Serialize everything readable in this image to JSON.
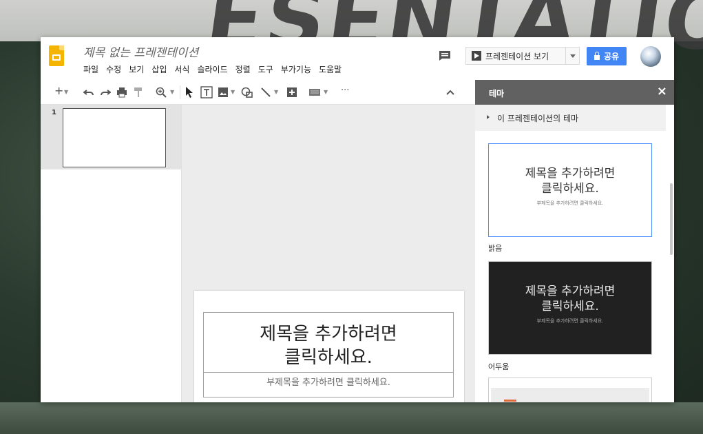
{
  "background": {
    "watermark": "ESENTATIO"
  },
  "header": {
    "doc_title": "제목 없는 프레젠테이션",
    "menu": [
      "파일",
      "수정",
      "보기",
      "삽입",
      "서식",
      "슬라이드",
      "정렬",
      "도구",
      "부가기능",
      "도움말"
    ],
    "present_label": "프레젠테이션 보기",
    "share_label": "공유",
    "accent_color": "#4285f4"
  },
  "toolbar": {
    "icons": [
      "plus-icon",
      "undo-icon",
      "redo-icon",
      "print-icon",
      "paint-format-icon",
      "zoom-icon",
      "select-icon",
      "text-box-icon",
      "image-icon",
      "shape-icon",
      "line-icon",
      "add-comment-icon",
      "layout-icon",
      "more-icon",
      "collapse-icon"
    ]
  },
  "filmstrip": {
    "slides": [
      {
        "number": "1"
      }
    ]
  },
  "slide": {
    "title_placeholder": "제목을 추가하려면\n클릭하세요.",
    "subtitle_placeholder": "부제목을 추가하려면 클릭하세요."
  },
  "theme_panel": {
    "title": "테마",
    "close": "×",
    "section_label": "이 프레젠테이션의 테마",
    "themes": [
      {
        "name": "밝음",
        "title": "제목을 추가하려면\n클릭하세요.",
        "subtitle": "부제목을 추가하려면 클릭하세요."
      },
      {
        "name": "어두움",
        "title": "제목을 추가하려면\n클릭하세요.",
        "subtitle": "부제목을 추가하려면 클릭하세요."
      }
    ]
  }
}
